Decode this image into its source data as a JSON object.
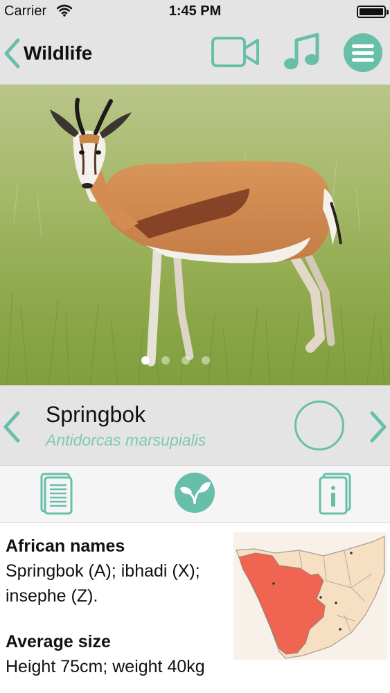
{
  "status_bar": {
    "carrier": "Carrier",
    "time": "1:45 PM"
  },
  "nav": {
    "back_label": "Wildlife",
    "icons": [
      "video-camera-icon",
      "music-note-icon",
      "menu-icon"
    ]
  },
  "gallery": {
    "page_count": 4,
    "active_page": 1
  },
  "species": {
    "name": "Springbok",
    "latin": "Antidorcas marsupialis"
  },
  "tabs": [
    "notes-icon",
    "leaf-icon",
    "info-icon"
  ],
  "details": {
    "african_names_heading": "African names",
    "african_names_value": "Springbok (A); ibhadi (X); insephe (Z).",
    "size_heading": "Average size",
    "size_value": "Height 75cm; weight 40kg"
  },
  "colors": {
    "accent": "#68bfa9",
    "latin_text": "#7fc8b7",
    "bar_bg": "#e4e4e4",
    "range_fill": "#ef6551"
  }
}
